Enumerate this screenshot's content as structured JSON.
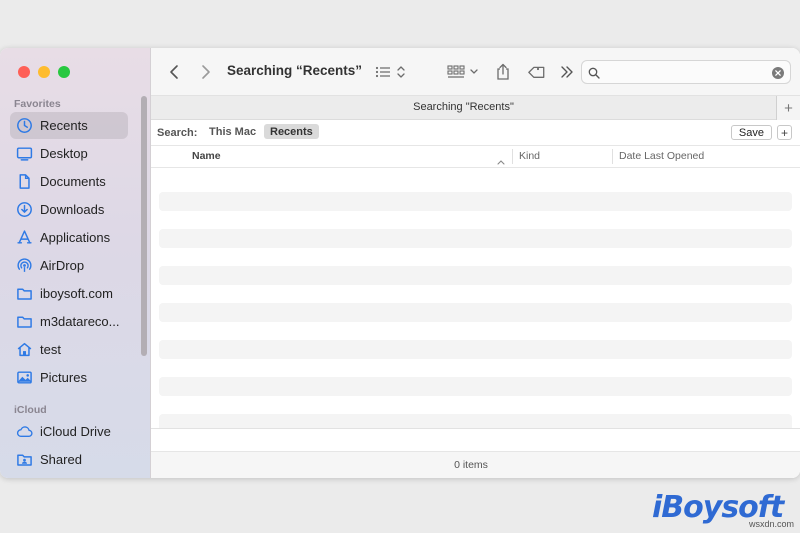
{
  "sidebar": {
    "sections": [
      {
        "label": "Favorites"
      },
      {
        "label": "iCloud"
      }
    ],
    "items": [
      {
        "label": "Recents",
        "icon": "clock-icon",
        "selected": true
      },
      {
        "label": "Desktop",
        "icon": "desktop-icon"
      },
      {
        "label": "Documents",
        "icon": "document-icon"
      },
      {
        "label": "Downloads",
        "icon": "download-icon"
      },
      {
        "label": "Applications",
        "icon": "applications-icon"
      },
      {
        "label": "AirDrop",
        "icon": "airdrop-icon"
      },
      {
        "label": "iboysoft.com",
        "icon": "folder-icon"
      },
      {
        "label": "m3datareco...",
        "icon": "folder-icon"
      },
      {
        "label": "test",
        "icon": "home-icon"
      },
      {
        "label": "Pictures",
        "icon": "pictures-icon"
      },
      {
        "label": "iCloud Drive",
        "icon": "cloud-icon"
      },
      {
        "label": "Shared",
        "icon": "shared-folder-icon"
      }
    ]
  },
  "toolbar": {
    "title": "Searching “Recents”",
    "search": {
      "value": "",
      "placeholder": ""
    }
  },
  "tab": {
    "title": "Searching \"Recents\"",
    "add_label": "+"
  },
  "scope": {
    "label": "Search:",
    "options": [
      {
        "label": "This Mac",
        "active": false
      },
      {
        "label": "Recents",
        "active": true
      }
    ],
    "save_label": "Save",
    "add_label": "+"
  },
  "columns": {
    "name": "Name",
    "kind": "Kind",
    "date": "Date Last Opened"
  },
  "status": {
    "text": "0 items"
  },
  "watermark": {
    "brand": "iBoysoft",
    "site": "wsxdn.com"
  },
  "colors": {
    "accent": "#2f7ae5",
    "close": "#fe5f57",
    "minimize": "#febc2e",
    "zoom": "#28c840",
    "brand": "#2f6ad3"
  }
}
